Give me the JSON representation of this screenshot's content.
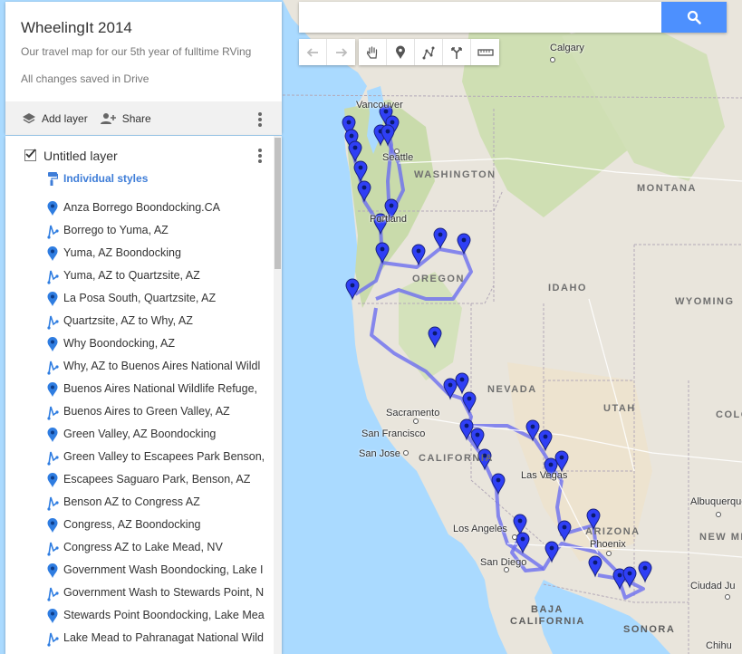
{
  "map_panel": {
    "title": "WheelingIt 2014",
    "description": "Our travel map for our 5th year of fulltime RVing",
    "save_status": "All changes saved in Drive",
    "add_layer_label": "Add layer",
    "share_label": "Share"
  },
  "layer": {
    "name": "Untitled layer",
    "styles_label": "Individual styles",
    "items": [
      {
        "type": "marker",
        "label": "Anza Borrego Boondocking.CA"
      },
      {
        "type": "route",
        "label": "Borrego to Yuma, AZ"
      },
      {
        "type": "marker",
        "label": "Yuma, AZ Boondocking"
      },
      {
        "type": "route",
        "label": "Yuma, AZ to Quartzsite, AZ"
      },
      {
        "type": "marker",
        "label": "La Posa South, Quartzsite, AZ"
      },
      {
        "type": "route",
        "label": "Quartzsite, AZ to Why, AZ"
      },
      {
        "type": "marker",
        "label": "Why Boondocking, AZ"
      },
      {
        "type": "route",
        "label": "Why, AZ to Buenos Aires National Wildl"
      },
      {
        "type": "marker",
        "label": "Buenos Aires National Wildlife Refuge,"
      },
      {
        "type": "route",
        "label": "Buenos Aires to Green Valley, AZ"
      },
      {
        "type": "marker",
        "label": "Green Valley, AZ Boondocking"
      },
      {
        "type": "route",
        "label": "Green Valley to Escapees Park Benson,"
      },
      {
        "type": "marker",
        "label": "Escapees Saguaro Park, Benson, AZ"
      },
      {
        "type": "route",
        "label": "Benson AZ to Congress AZ"
      },
      {
        "type": "marker",
        "label": "Congress, AZ Boondocking"
      },
      {
        "type": "route",
        "label": "Congress AZ to Lake Mead, NV"
      },
      {
        "type": "marker",
        "label": "Government Wash Boondocking, Lake I"
      },
      {
        "type": "route",
        "label": "Government Wash to Stewards Point, N"
      },
      {
        "type": "marker",
        "label": "Stewards Point Boondocking, Lake Mea"
      },
      {
        "type": "route",
        "label": "Lake Mead to Pahranagat National Wild"
      }
    ]
  },
  "search": {
    "value": "",
    "placeholder": ""
  },
  "toolbar": {
    "tools": [
      "undo-icon",
      "redo-icon",
      "hand-icon",
      "marker-icon",
      "draw-line-icon",
      "directions-icon",
      "ruler-icon"
    ]
  },
  "map_labels": {
    "states": [
      {
        "id": "washington",
        "text": "WASHINGTON"
      },
      {
        "id": "oregon",
        "text": "OREGON"
      },
      {
        "id": "idaho",
        "text": "IDAHO"
      },
      {
        "id": "montana",
        "text": "MONTANA"
      },
      {
        "id": "wyoming",
        "text": "WYOMING"
      },
      {
        "id": "nevada",
        "text": "NEVADA"
      },
      {
        "id": "utah",
        "text": "UTAH"
      },
      {
        "id": "colorado",
        "text": "COLO"
      },
      {
        "id": "california",
        "text": "CALIFORNIA"
      },
      {
        "id": "arizona",
        "text": "ARIZONA"
      },
      {
        "id": "new-mexico",
        "text": "NEW ME"
      }
    ],
    "countries": [
      {
        "id": "baja",
        "text": "BAJA"
      },
      {
        "id": "baja-california",
        "text": "CALIFORNIA"
      },
      {
        "id": "sonora",
        "text": "SONORA"
      }
    ],
    "cities": [
      {
        "id": "calgary",
        "text": "Calgary"
      },
      {
        "id": "vancouver",
        "text": "Vancouver"
      },
      {
        "id": "seattle",
        "text": "Seattle"
      },
      {
        "id": "portland",
        "text": "Portland"
      },
      {
        "id": "sacramento",
        "text": "Sacramento"
      },
      {
        "id": "san-francisco",
        "text": "San Francisco"
      },
      {
        "id": "san-jose",
        "text": "San Jose"
      },
      {
        "id": "las-vegas",
        "text": "Las Vegas"
      },
      {
        "id": "los-angeles",
        "text": "Los Angeles"
      },
      {
        "id": "san-diego",
        "text": "San Diego"
      },
      {
        "id": "phoenix",
        "text": "Phoenix"
      },
      {
        "id": "albuquerque",
        "text": "Albuquerque"
      },
      {
        "id": "ciudad-juarez",
        "text": "Ciudad Ju"
      },
      {
        "id": "chihuahua",
        "text": "Chihu"
      }
    ]
  },
  "colors": {
    "route": "#6b6ef0",
    "marker": "#2f3ff5",
    "land": "#e9e5dc",
    "water": "#aadaff",
    "accent": "#4d90fe"
  }
}
